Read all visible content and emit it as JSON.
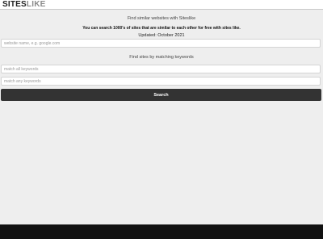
{
  "header": {
    "logo_main": "SITES",
    "logo_accent": "LIKE"
  },
  "main": {
    "heading": "Find similar websites with Siteslike",
    "subheading": "You can search 1000's of sites that are similar to each other for free with sites like.",
    "updated": "Updated: October 2021",
    "site_input": {
      "value": "",
      "placeholder": "website name, e.g. google.com"
    },
    "keywords_heading": "Find sites by matching keywords",
    "all_keywords_input": {
      "value": "",
      "placeholder": "match all keywords"
    },
    "any_keywords_input": {
      "value": "",
      "placeholder": "match any keywords"
    },
    "search_label": "Search"
  },
  "colors": {
    "button_bg": "#333333",
    "page_bg": "#eeeeee",
    "footer_bg": "#111111"
  }
}
